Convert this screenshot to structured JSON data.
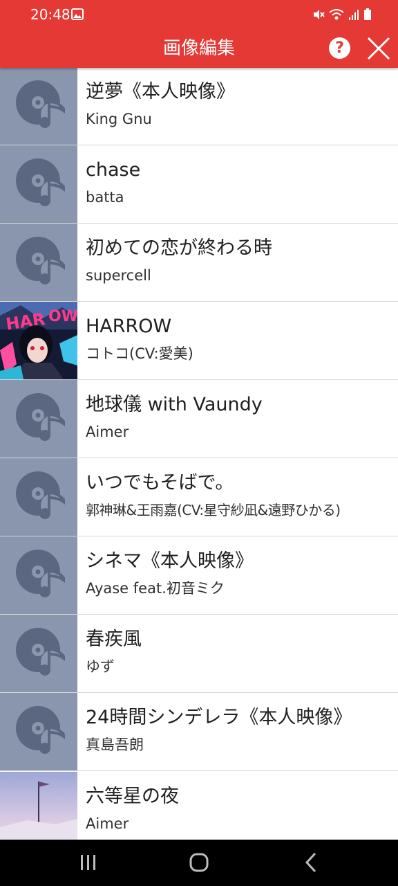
{
  "status_bar": {
    "time": "20:48",
    "background": "#e53935",
    "icons": [
      "gallery-icon",
      "mute-icon",
      "wifi-icon",
      "signal-icon",
      "battery-icon"
    ]
  },
  "header": {
    "title": "画像編集",
    "help_label": "?",
    "close_icon": "close-icon",
    "background": "#e53935"
  },
  "songs": [
    {
      "title": "逆夢《本人映像》",
      "artist": "King Gnu",
      "artwork": "default-music-icon"
    },
    {
      "title": "chase",
      "artist": "batta",
      "artwork": "default-music-icon"
    },
    {
      "title": "初めての恋が終わる時",
      "artist": "supercell",
      "artwork": "default-music-icon"
    },
    {
      "title": "HARROW",
      "artist": "コトコ(CV:愛美)",
      "artwork": "album-art"
    },
    {
      "title": "地球儀 with Vaundy",
      "artist": "Aimer",
      "artwork": "default-music-icon"
    },
    {
      "title": "いつでもそばで。",
      "artist": "郭神琳&王雨嘉(CV:星守紗凪&遠野ひかる)",
      "artwork": "default-music-icon"
    },
    {
      "title": "シネマ《本人映像》",
      "artist": "Ayase feat.初音ミク",
      "artwork": "default-music-icon"
    },
    {
      "title": "春疾風",
      "artist": "ゆず",
      "artwork": "default-music-icon"
    },
    {
      "title": "24時間シンデレラ《本人映像》",
      "artist": "真島吾朗",
      "artwork": "default-music-icon"
    },
    {
      "title": "六等星の夜",
      "artist": "Aimer",
      "artwork": "album-art"
    }
  ],
  "nav_bar": {
    "buttons": [
      "recent-apps-icon",
      "home-icon",
      "back-icon"
    ]
  }
}
